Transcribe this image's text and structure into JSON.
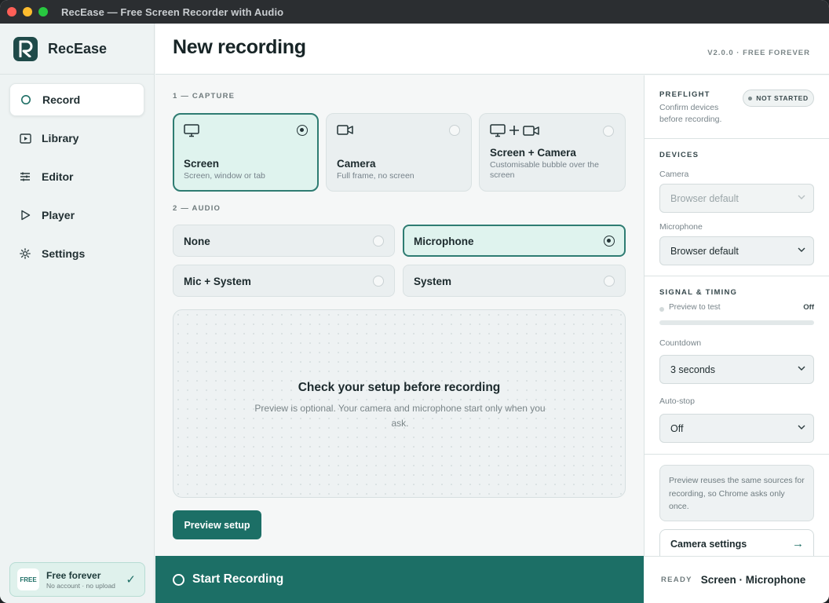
{
  "window": {
    "title": "RecEase — Free Screen Recorder with Audio"
  },
  "brand": {
    "name": "RecEase"
  },
  "sidebar": {
    "items": [
      {
        "label": "Record",
        "icon": "circle-icon",
        "active": true
      },
      {
        "label": "Library",
        "icon": "play-square-icon",
        "active": false
      },
      {
        "label": "Editor",
        "icon": "sliders-icon",
        "active": false
      },
      {
        "label": "Player",
        "icon": "play-icon",
        "active": false
      },
      {
        "label": "Settings",
        "icon": "gear-icon",
        "active": false
      }
    ],
    "plan": {
      "badge": "FREE",
      "title": "Free forever",
      "subtitle": "No account · no upload",
      "check": "✓"
    }
  },
  "header": {
    "title": "New recording",
    "version": "V2.0.0 · FREE FOREVER"
  },
  "capture": {
    "section_label": "1 — CAPTURE",
    "options": [
      {
        "title": "Screen",
        "subtitle": "Screen, window or tab",
        "selected": true,
        "icon": "monitor-icon"
      },
      {
        "title": "Camera",
        "subtitle": "Full frame, no screen",
        "selected": false,
        "icon": "video-camera-icon"
      },
      {
        "title": "Screen + Camera",
        "subtitle": "Customisable bubble over the screen",
        "selected": false,
        "icon": "monitor-plus-camera-icon"
      }
    ]
  },
  "audio": {
    "section_label": "2 — AUDIO",
    "options": [
      {
        "label": "None",
        "selected": false
      },
      {
        "label": "Microphone",
        "selected": true
      },
      {
        "label": "Mic + System",
        "selected": false
      },
      {
        "label": "System",
        "selected": false
      }
    ]
  },
  "preview": {
    "title": "Check your setup before recording",
    "subtitle": "Preview is optional. Your camera and microphone start only when you ask.",
    "button": "Preview setup"
  },
  "start": {
    "label": "Start Recording"
  },
  "status": {
    "label": "READY",
    "value": "Screen · Microphone"
  },
  "right": {
    "preflight": {
      "heading": "PREFLIGHT",
      "text": "Confirm devices before recording.",
      "badge": "NOT STARTED"
    },
    "devices": {
      "heading": "DEVICES",
      "camera_label": "Camera",
      "camera_value": "Browser default",
      "mic_label": "Microphone",
      "mic_value": "Browser default"
    },
    "signal": {
      "heading": "SIGNAL & TIMING",
      "preview_label": "Preview to test",
      "preview_state": "Off",
      "level": 0,
      "countdown_label": "Countdown",
      "countdown_value": "3 seconds",
      "autostop_label": "Auto-stop",
      "autostop_value": "Off"
    },
    "note": "Preview reuses the same sources for recording, so Chrome asks only once.",
    "camera_settings": "Camera settings",
    "camera_settings_arrow": "→"
  },
  "colors": {
    "accent": "#1c6f66",
    "selected_bg": "#dff3ee",
    "titlebar": "#2b2e31"
  }
}
